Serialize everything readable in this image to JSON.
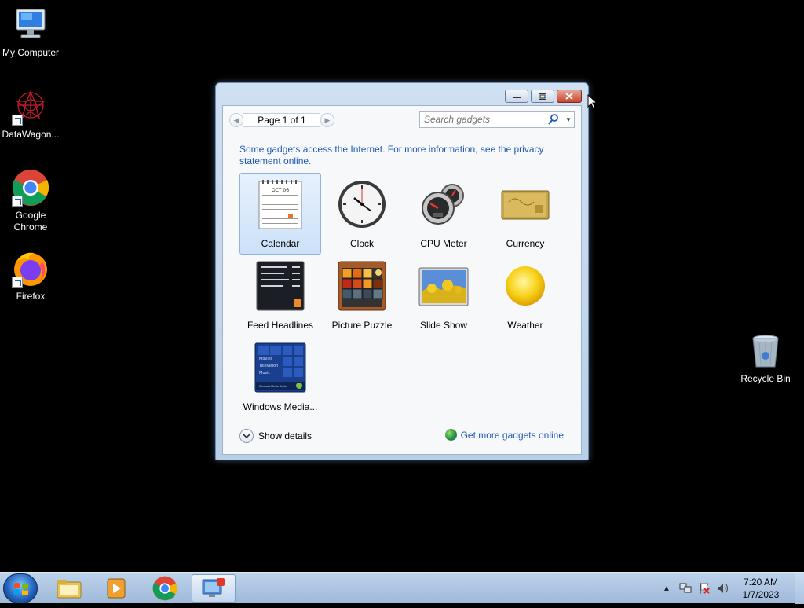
{
  "desktop": {
    "icons": [
      {
        "label": "My Computer"
      },
      {
        "label": "DataWagon..."
      },
      {
        "label": "Google Chrome"
      },
      {
        "label": "Firefox"
      },
      {
        "label": "Recycle Bin"
      }
    ]
  },
  "gadget_window": {
    "page_indicator": "Page 1 of 1",
    "search_placeholder": "Search gadgets",
    "info_text": "Some gadgets access the Internet.  For more information, see the privacy statement online.",
    "gadgets": [
      {
        "label": "Calendar",
        "icon": "calendar-icon"
      },
      {
        "label": "Clock",
        "icon": "clock-icon"
      },
      {
        "label": "CPU Meter",
        "icon": "cpu-meter-icon"
      },
      {
        "label": "Currency",
        "icon": "currency-icon"
      },
      {
        "label": "Feed Headlines",
        "icon": "feed-headlines-icon"
      },
      {
        "label": "Picture Puzzle",
        "icon": "picture-puzzle-icon"
      },
      {
        "label": "Slide Show",
        "icon": "slide-show-icon"
      },
      {
        "label": "Weather",
        "icon": "weather-icon"
      },
      {
        "label": "Windows Media...",
        "icon": "windows-media-icon"
      }
    ],
    "calendar_month": "OCT 06",
    "media_center_items": [
      "Movies",
      "Television",
      "Music"
    ],
    "media_center_label": "Windows Media Center",
    "show_details": "Show details",
    "get_more": "Get more gadgets online"
  },
  "taskbar": {
    "time": "7:20 AM",
    "date": "1/7/2023",
    "pinned": [
      "file-explorer-icon",
      "media-player-icon",
      "chrome-icon",
      "gadgets-icon"
    ]
  },
  "colors": {
    "link_blue": "#1e5ab4",
    "selection": "#cce1f8",
    "desktop_bg": "#000000"
  }
}
